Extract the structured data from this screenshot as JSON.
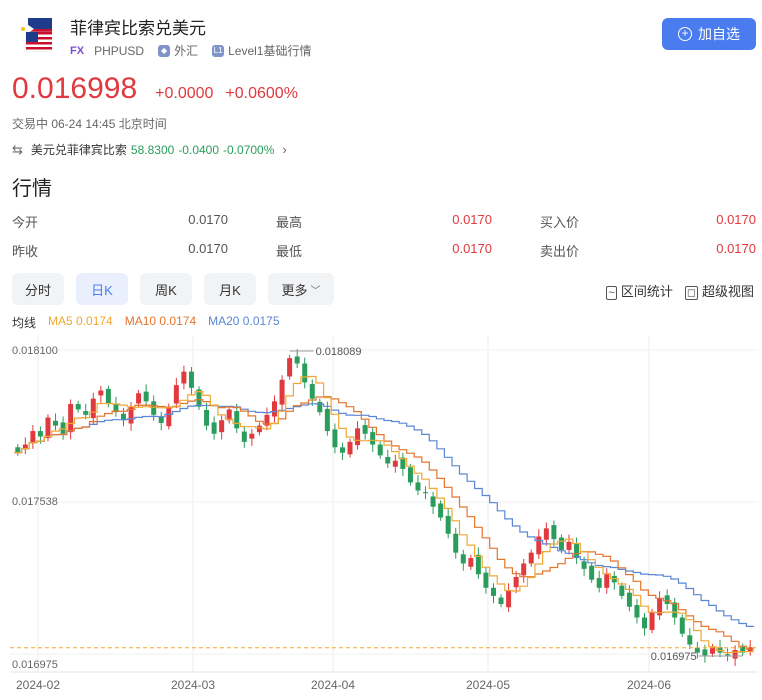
{
  "header": {
    "title": "菲律宾比索兑美元",
    "fx_badge": "FX",
    "symbol": "PHPUSD",
    "market_label": "外汇",
    "level_badge": "L1",
    "level_label": "Level1基础行情",
    "add_button": "加自选"
  },
  "price": {
    "last": "0.016998",
    "change": "+0.0000",
    "change_pct": "+0.0600%",
    "status": "交易中 06-24 14:45 北京时间"
  },
  "reverse_pair": {
    "label": "美元兑菲律宾比索",
    "value": "58.8300",
    "change": "-0.0400",
    "change_pct": "-0.0700%"
  },
  "section_title": "行情",
  "quote": {
    "open_label": "今开",
    "open": "0.0170",
    "high_label": "最高",
    "high": "0.0170",
    "bid_label": "买入价",
    "bid": "0.0170",
    "prev_label": "昨收",
    "prev": "0.0170",
    "low_label": "最低",
    "low": "0.0170",
    "ask_label": "卖出价",
    "ask": "0.0170"
  },
  "tabs": {
    "fenshi": "分时",
    "day": "日K",
    "week": "周K",
    "month": "月K",
    "more": "更多"
  },
  "tools": {
    "range_stats": "区间统计",
    "super_view": "超级视图"
  },
  "ma": {
    "label": "均线",
    "ma5": "MA5 0.0174",
    "ma10": "MA10 0.0174",
    "ma20": "MA20 0.0175"
  },
  "colors": {
    "up": "#e0393e",
    "down": "#2a9d5c",
    "ma5": "#f0a833",
    "ma10": "#e5742c",
    "ma20": "#5b86d6",
    "accent": "#4a7cf0"
  },
  "chart_data": {
    "type": "candlestick",
    "y_labels": [
      "0.018100",
      "0.017538",
      "0.016975"
    ],
    "ylim": [
      0.016975,
      0.0181
    ],
    "x_labels": [
      "2024-02",
      "2024-03",
      "2024-04",
      "2024-05",
      "2024-06"
    ],
    "max_marker": "0.018089",
    "min_marker": "0.016975",
    "current_price": 0.016998,
    "candles_close": [
      0.01772,
      0.01775,
      0.0178,
      0.01778,
      0.01785,
      0.01782,
      0.01779,
      0.0179,
      0.01788,
      0.01786,
      0.01792,
      0.01795,
      0.0179,
      0.01787,
      0.01784,
      0.01789,
      0.01794,
      0.01791,
      0.01786,
      0.01783,
      0.01789,
      0.01797,
      0.01802,
      0.01796,
      0.01789,
      0.01782,
      0.01779,
      0.01784,
      0.01788,
      0.01781,
      0.01776,
      0.01779,
      0.01782,
      0.01786,
      0.01791,
      0.01799,
      0.01807,
      0.01805,
      0.01798,
      0.01792,
      0.01787,
      0.0178,
      0.01774,
      0.01772,
      0.01776,
      0.01781,
      0.01779,
      0.01775,
      0.01771,
      0.01768,
      0.01769,
      0.01766,
      0.01761,
      0.01758,
      0.01757,
      0.01752,
      0.01748,
      0.01742,
      0.01735,
      0.01731,
      0.01733,
      0.01727,
      0.01722,
      0.01719,
      0.01716,
      0.01721,
      0.01726,
      0.01731,
      0.01735,
      0.01741,
      0.01744,
      0.0174,
      0.01736,
      0.01739,
      0.01733,
      0.01729,
      0.01725,
      0.01722,
      0.01727,
      0.01724,
      0.01719,
      0.01715,
      0.01711,
      0.01707,
      0.01713,
      0.01718,
      0.01716,
      0.01711,
      0.01705,
      0.01701,
      0.01698,
      0.01697,
      0.017,
      0.01698,
      0.01697,
      0.01699,
      0.01698,
      0.017
    ]
  }
}
